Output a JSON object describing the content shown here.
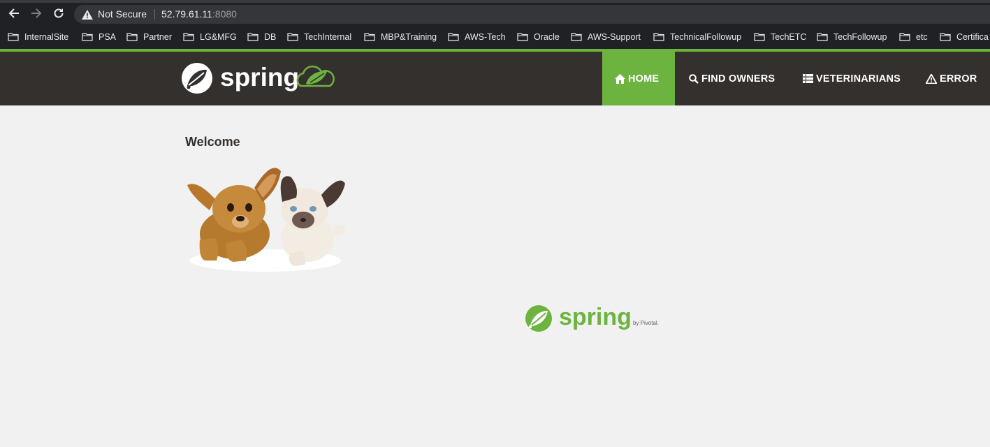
{
  "browser": {
    "back_icon": "arrow-left-icon",
    "forward_icon": "arrow-right-icon",
    "reload_icon": "reload-icon",
    "security_icon": "warning-triangle-icon",
    "security_label": "Not Secure",
    "url_host": "52.79.61.11",
    "url_port": ":8080"
  },
  "bookmarks": [
    {
      "label": "InternalSite"
    },
    {
      "label": "PSA"
    },
    {
      "label": "Partner"
    },
    {
      "label": "LG&MFG"
    },
    {
      "label": "DB"
    },
    {
      "label": "TechInternal"
    },
    {
      "label": "MBP&Training"
    },
    {
      "label": "AWS-Tech"
    },
    {
      "label": "Oracle"
    },
    {
      "label": "AWS-Support"
    },
    {
      "label": "TechnicalFollowup"
    },
    {
      "label": "TechETC"
    },
    {
      "label": "TechFollowup"
    },
    {
      "label": "etc"
    },
    {
      "label": "Certifica"
    }
  ],
  "app": {
    "brand_text": "spring",
    "colors": {
      "accent": "#6db33f",
      "navbar": "#34302d",
      "background": "#f1f1f1"
    },
    "nav": {
      "home": "HOME",
      "find_owners": "FIND OWNERS",
      "veterinarians": "VETERINARIANS",
      "error": "ERROR"
    },
    "welcome": "Welcome",
    "footer": {
      "brand_text": "spring",
      "by_text": "by Pivotal."
    }
  }
}
